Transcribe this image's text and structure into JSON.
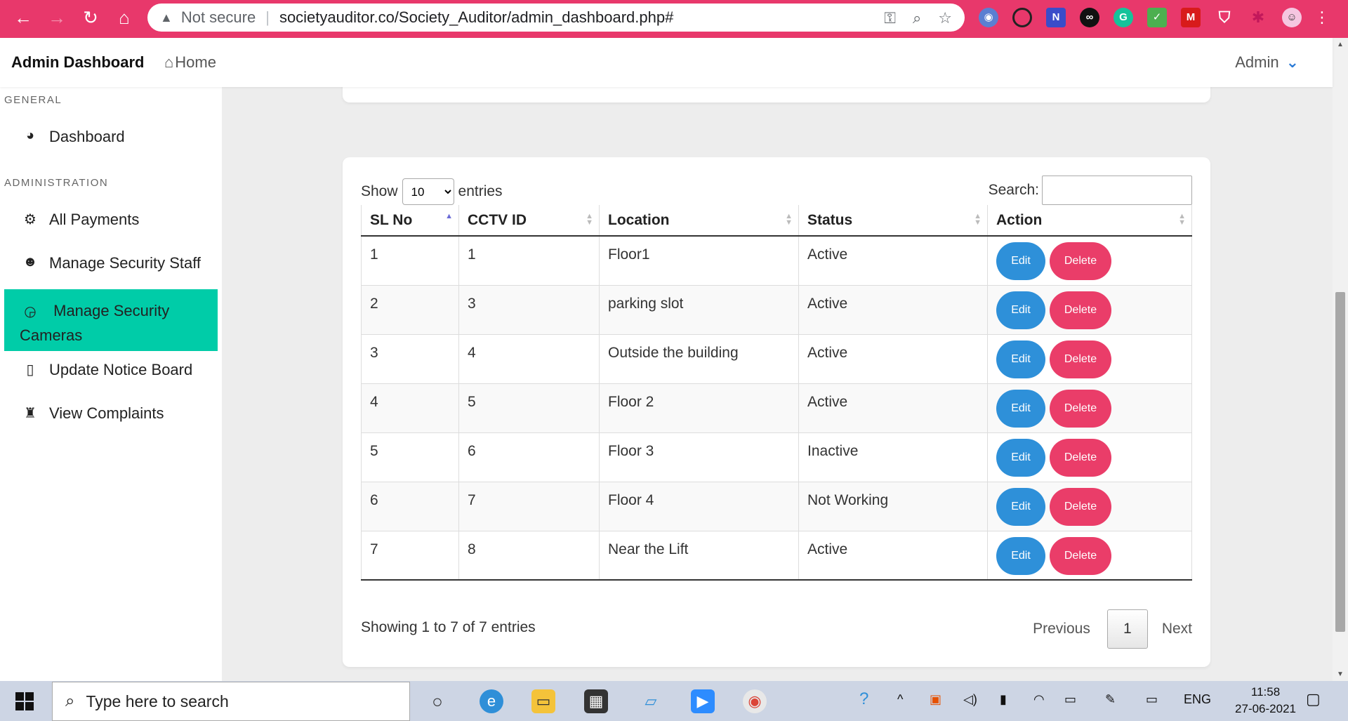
{
  "browser": {
    "security": "Not secure",
    "url": "societyauditor.co/Society_Auditor/admin_dashboard.php#"
  },
  "header": {
    "brand": "Admin Dashboard",
    "home": "Home",
    "user": "Admin"
  },
  "sidebar": {
    "sections": [
      {
        "title": "GENERAL"
      },
      {
        "title": "ADMINISTRATION"
      }
    ],
    "items": [
      {
        "label": "Dashboard",
        "icon": "tachometer-icon"
      },
      {
        "label": "All Payments",
        "icon": "gears-icon"
      },
      {
        "label": "Manage Security Staff",
        "icon": "users-icon"
      },
      {
        "label": "Manage Security Cameras",
        "icon": "headset-icon",
        "active": true
      },
      {
        "label": "Update Notice Board",
        "icon": "clipboard-icon"
      },
      {
        "label": "View Complaints",
        "icon": "user-secret-icon"
      }
    ]
  },
  "table_controls": {
    "show_label": "Show",
    "page_size": "10",
    "entries_label": "entries",
    "search_label": "Search:"
  },
  "table": {
    "columns": [
      "SL No",
      "CCTV ID",
      "Location",
      "Status",
      "Action"
    ],
    "rows": [
      {
        "sl": "1",
        "cctv": "1",
        "location": "Floor1",
        "status": "Active"
      },
      {
        "sl": "2",
        "cctv": "3",
        "location": "parking slot",
        "status": "Active"
      },
      {
        "sl": "3",
        "cctv": "4",
        "location": "Outside the building",
        "status": "Active"
      },
      {
        "sl": "4",
        "cctv": "5",
        "location": "Floor 2",
        "status": "Active"
      },
      {
        "sl": "5",
        "cctv": "6",
        "location": "Floor 3",
        "status": "Inactive"
      },
      {
        "sl": "6",
        "cctv": "7",
        "location": "Floor 4",
        "status": "Not Working"
      },
      {
        "sl": "7",
        "cctv": "8",
        "location": "Near the Lift",
        "status": "Active"
      }
    ],
    "edit_label": "Edit",
    "delete_label": "Delete"
  },
  "footer": {
    "info": "Showing 1 to 7 of 7 entries",
    "previous": "Previous",
    "page": "1",
    "next": "Next"
  },
  "taskbar": {
    "search_placeholder": "Type here to search",
    "language": "ENG",
    "time": "11:58",
    "date": "27-06-2021"
  },
  "colors": {
    "chrome": "#e8386b",
    "active_nav": "#00cca8",
    "edit": "#2e90d9",
    "delete": "#ea3d69"
  }
}
